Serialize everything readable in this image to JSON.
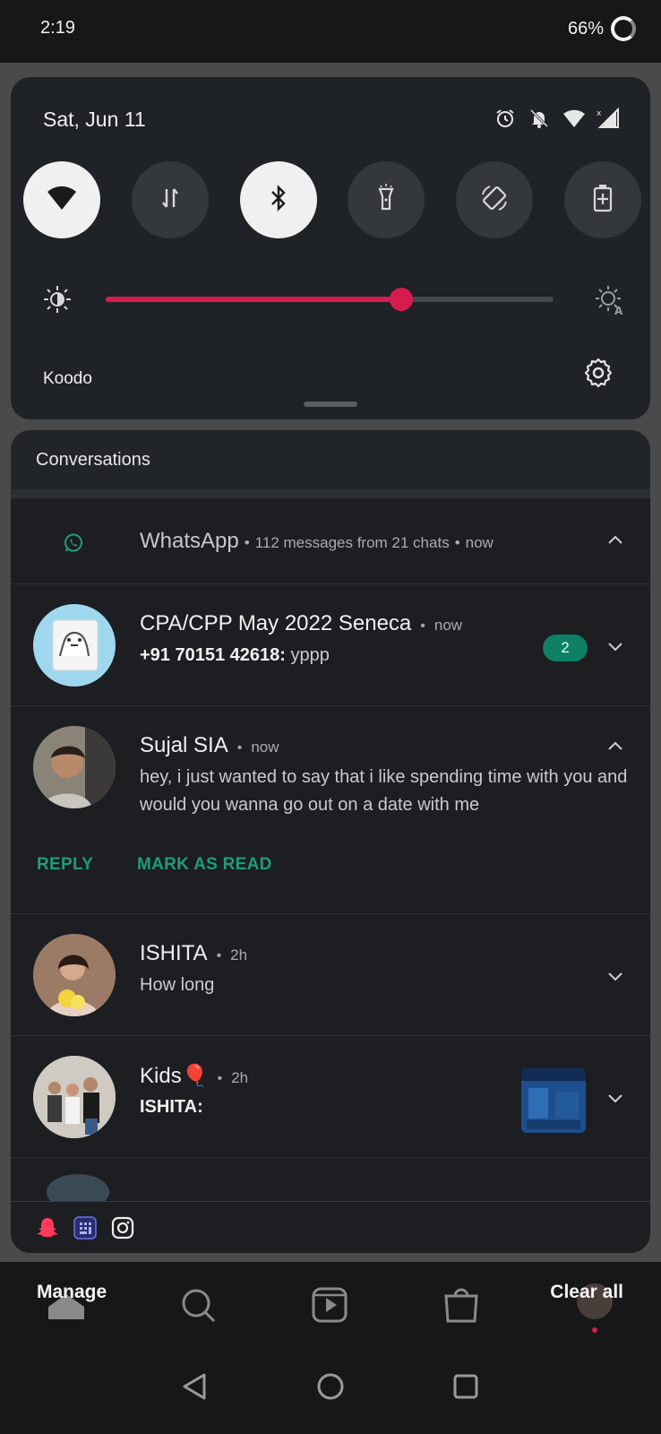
{
  "status_bar": {
    "time": "2:19",
    "battery": "66%"
  },
  "quick_settings": {
    "date": "Sat, Jun 11",
    "status_icons": [
      "alarm-icon",
      "bell-off-icon",
      "wifi-icon",
      "cellular-no-data-icon"
    ],
    "tiles": [
      {
        "name": "wifi",
        "icon": "wifi-icon",
        "active": true
      },
      {
        "name": "mobile-data",
        "icon": "data-arrows-icon",
        "active": false
      },
      {
        "name": "bluetooth",
        "icon": "bluetooth-icon",
        "active": true
      },
      {
        "name": "flashlight",
        "icon": "flashlight-icon",
        "active": false
      },
      {
        "name": "auto-rotate",
        "icon": "rotate-icon",
        "active": false
      },
      {
        "name": "battery-saver",
        "icon": "battery-saver-icon",
        "active": false
      }
    ],
    "brightness_level": 0.66,
    "accent_color": "#d61c4e",
    "carrier": "Koodo"
  },
  "notifications": {
    "section_title": "Conversations",
    "whatsapp": {
      "app": "WhatsApp",
      "summary": "112 messages from 21 chats",
      "when": "now",
      "bullet": "•"
    },
    "items": [
      {
        "name": "CPA/CPP May 2022 Seneca",
        "when": "now",
        "sender": "+91 70151 42618:",
        "text": "yppp",
        "badge": "2"
      },
      {
        "name": "Sujal SIA",
        "when": "now",
        "text": "hey, i just wanted to say that i like spending time with you and would you wanna go out on a date with me",
        "actions": [
          "REPLY",
          "MARK AS READ"
        ]
      },
      {
        "name": "ISHITA",
        "when": "2h",
        "text": "How long"
      },
      {
        "name": "Kids🎈",
        "when": "2h",
        "text": "ISHITA:"
      }
    ],
    "app_strip": [
      "snapchat-icon",
      "calculator-icon",
      "instagram-icon"
    ]
  },
  "bottom": {
    "manage_label": "Manage",
    "clear_all_label": "Clear all"
  },
  "colors": {
    "whatsapp_green": "#1f9c78",
    "badge_green": "#0f7f66"
  }
}
